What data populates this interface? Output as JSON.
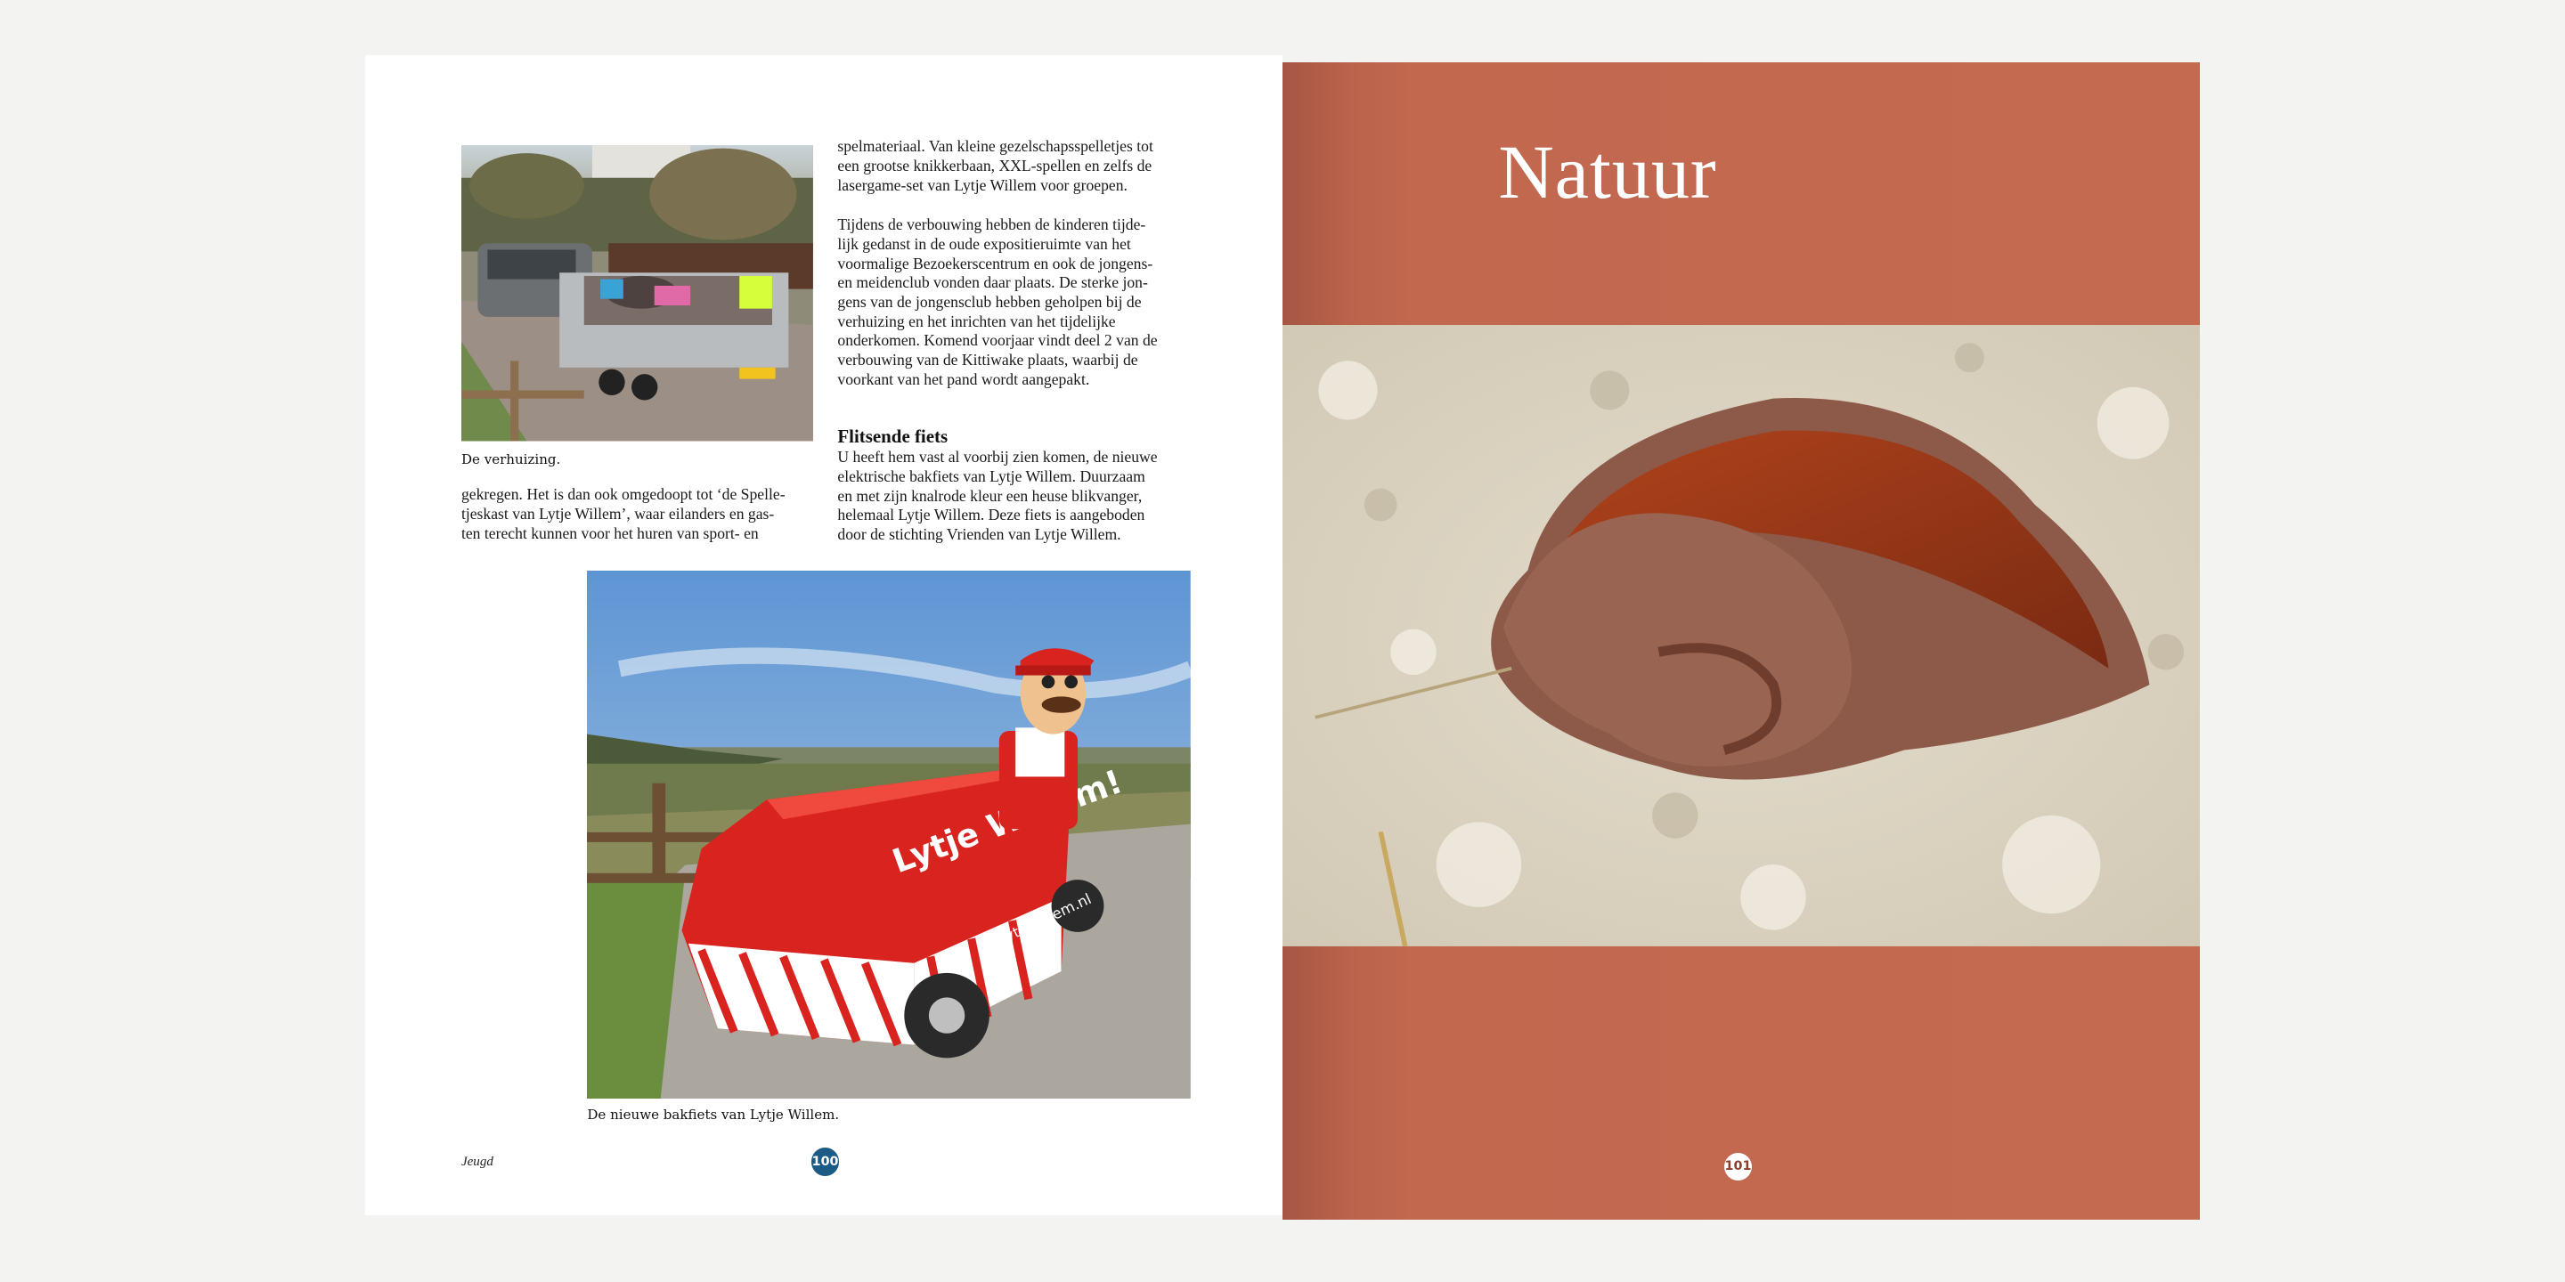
{
  "left_page": {
    "photo_move": {
      "alt": "De verhuizing.",
      "icon": "photo-trailer"
    },
    "caption_move": "De verhuizing.",
    "para_left": "gekregen. Het is dan ook omgedoopt tot ‘de Spelle-\ntjeskast van Lytje Willem’, waar eilanders en gas-\nten terecht kunnen voor het huren van sport- en",
    "para_right_1": "spelmateriaal. Van kleine gezelschapsspelletjes tot\neen grootse knikkerbaan, XXL-spellen en zelfs de\nlasergame-set van Lytje Willem voor groepen.",
    "para_right_2": "Tijdens de verbouwing hebben de kinderen tijde-\nlijk gedanst in de oude expositieruimte van het\nvoormalige Bezoekerscentrum en ook de jongens-\nen meidenclub vonden daar plaats. De sterke jon-\ngens van de jongensclub hebben geholpen bij de\nverhuizing en het inrichten van het tijdelijke\nonderkomen. Komend voorjaar vindt deel 2 van de\nverbouwing van de Kittiwake plaats, waarbij de\nvoorkant van het pand wordt aangepakt.",
    "heading": "Flitsende fiets",
    "para_right_3": "U heeft hem vast al voorbij zien komen, de nieuwe\nelektrische bakfiets van Lytje Willem. Duurzaam\nen met zijn knalrode kleur een heuse blikvanger,\nhelemaal Lytje Willem. Deze fiets is aangeboden\ndoor de stichting Vrienden van Lytje Willem.",
    "photo_bike": {
      "alt": "De nieuwe bakfiets van Lytje Willem.",
      "icon": "photo-cargo-bike",
      "brand_text": "Lytje Willem!",
      "url_text": "lytjewillem.nl"
    },
    "caption_bike": "De nieuwe bakfiets van Lytje Willem.",
    "footer_section": "Jeugd",
    "page_number": "100"
  },
  "right_page": {
    "chapter_title": "Natuur",
    "photo_fungus": {
      "alt": "Natuur",
      "icon": "photo-cup-fungus-in-sand"
    },
    "page_number": "101"
  },
  "colors": {
    "chapter_background": "#c36a51",
    "page_number_left_bg": "#1b5b86",
    "bike_red": "#d8231f"
  }
}
